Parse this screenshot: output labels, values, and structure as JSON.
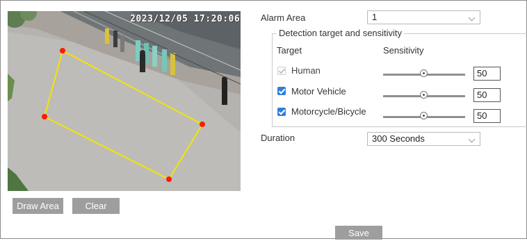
{
  "preview": {
    "timestamp": "2023/12/05 17:20:06",
    "area_color": "#f2e600",
    "vertex_color": "#ff1a00"
  },
  "buttons": {
    "draw_area": "Draw Area",
    "clear": "Clear",
    "save": "Save"
  },
  "settings": {
    "alarm_area_label": "Alarm Area",
    "alarm_area_value": "1",
    "detection_group_title": "Detection target and sensitivity",
    "target_header": "Target",
    "sensitivity_header": "Sensitivity",
    "targets": [
      {
        "label": "Human",
        "checked": true,
        "disabled": true,
        "sensitivity": "50",
        "slider_fraction": 0.5
      },
      {
        "label": "Motor Vehicle",
        "checked": true,
        "disabled": false,
        "sensitivity": "50",
        "slider_fraction": 0.5
      },
      {
        "label": "Motorcycle/Bicycle",
        "checked": true,
        "disabled": false,
        "sensitivity": "50",
        "slider_fraction": 0.5
      }
    ],
    "duration_label": "Duration",
    "duration_value": "300 Seconds"
  },
  "colors": {
    "button_bg": "#9e9e9e",
    "checkbox_accent": "#2f7fd9"
  },
  "icons": {
    "dropdown": "chevron-down-icon",
    "checkbox": "check-icon"
  }
}
